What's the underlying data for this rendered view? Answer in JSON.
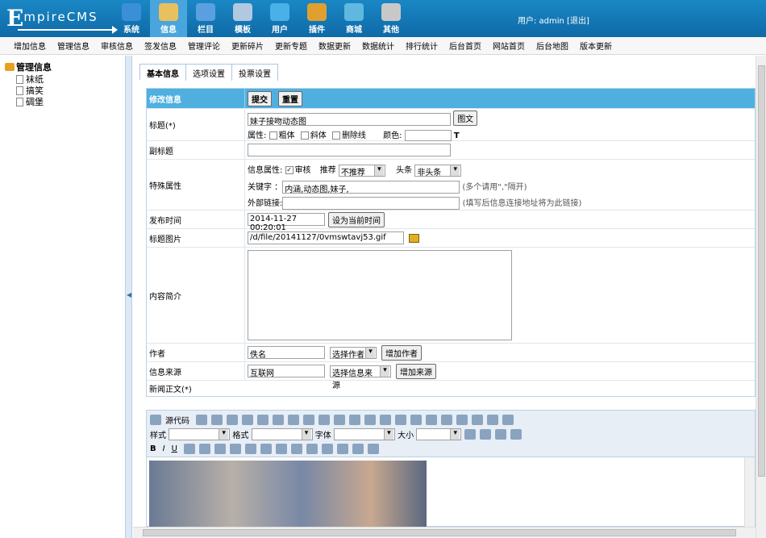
{
  "logo": {
    "first": "E",
    "rest": "mpireCMS"
  },
  "nav": [
    {
      "label": "系统",
      "color": "#3a8fd8"
    },
    {
      "label": "信息",
      "color": "#e8c060"
    },
    {
      "label": "栏目",
      "color": "#5aa0e0"
    },
    {
      "label": "模板",
      "color": "#b0c8e0"
    },
    {
      "label": "用户",
      "color": "#4ab0e8"
    },
    {
      "label": "插件",
      "color": "#e0a030"
    },
    {
      "label": "商城",
      "color": "#60b8e0"
    },
    {
      "label": "其他",
      "color": "#c8c8c8"
    }
  ],
  "user": {
    "text": "用户: admin [退出]"
  },
  "menu": [
    "增加信息",
    "管理信息",
    "审核信息",
    "签发信息",
    "管理评论",
    "更新碎片",
    "更新专题",
    "数据更新",
    "数据统计",
    "排行统计",
    "后台首页",
    "网站首页",
    "后台地图",
    "版本更新"
  ],
  "sidebar": {
    "root": "管理信息",
    "items": [
      "袜纸",
      "搞笑",
      "碉堡"
    ]
  },
  "tabs": [
    "基本信息",
    "选项设置",
    "投票设置"
  ],
  "form": {
    "header_label": "修改信息",
    "submit": "提交",
    "reset": "重置",
    "title_label": "标题(*)",
    "title_value": "妹子接吻动态图",
    "title_btn": "图文",
    "attr_label": "属性:",
    "bold": "粗体",
    "italic": "斜体",
    "strike": "删除线",
    "color_label": "颜色:",
    "subtitle_label": "副标题",
    "special_label": "特殊属性",
    "info_attr": "信息属性:",
    "audit": "审核",
    "recommend_label": "推荐",
    "recommend_val": "不推荐",
    "headline_label": "头条",
    "headline_val": "非头条",
    "keyword_label": "关键字 ：",
    "keyword_val": "内涵,动态图,妹子,",
    "keyword_hint": "(多个请用\",\"隔开)",
    "link_label": "外部链接:",
    "link_hint": "(填写后信息连接地址将为此链接)",
    "time_label": "发布时间",
    "time_val": "2014-11-27 00:20:01",
    "time_btn": "设为当前时间",
    "pic_label": "标题图片",
    "pic_val": "/d/file/20141127/0vmswtavj53.gif",
    "intro_label": "内容简介",
    "author_label": "作者",
    "author_val": "佚名",
    "author_sel": "选择作者",
    "author_btn": "增加作者",
    "source_label": "信息来源",
    "source_val": "互联网",
    "source_sel": "选择信息来源",
    "source_btn": "增加来源",
    "body_label": "新闻正文(*)"
  },
  "editor": {
    "source": "源代码",
    "style": "样式",
    "format": "格式",
    "font": "字体",
    "size": "大小"
  }
}
